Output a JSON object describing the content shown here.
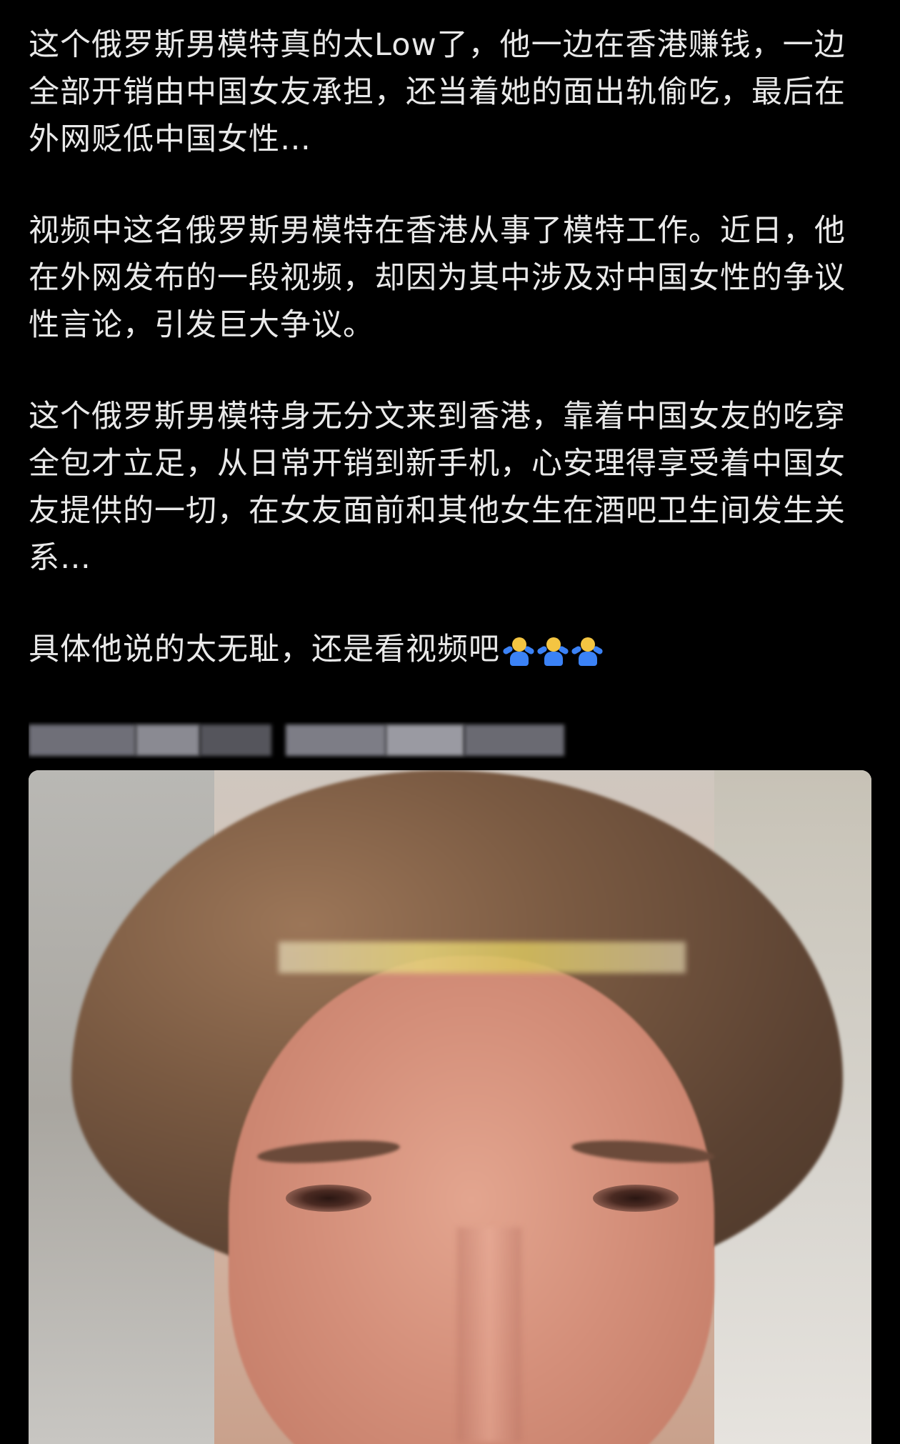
{
  "post": {
    "paragraphs": [
      "这个俄罗斯男模特真的太Low了，他一边在香港赚钱，一边全部开销由中国女友承担，还当着她的面出轨偷吃，最后在外网贬低中国女性…",
      "视频中这名俄罗斯男模特在香港从事了模特工作。近日，他在外网发布的一段视频，却因为其中涉及对中国女性的争议性言论，引发巨大争议。",
      "这个俄罗斯男模特身无分文来到香港，靠着中国女友的吃穿全包才立足，从日常开销到新手机，心安理得享受着中国女友提供的一切，在女友面前和其他女生在酒吧卫生间发生关系…",
      "具体他说的太无耻，还是看视频吧"
    ],
    "emojis": [
      "person-shrugging-icon",
      "person-shrugging-icon",
      "person-shrugging-icon"
    ]
  },
  "colors": {
    "background": "#000000",
    "text": "#e9e9e9"
  }
}
